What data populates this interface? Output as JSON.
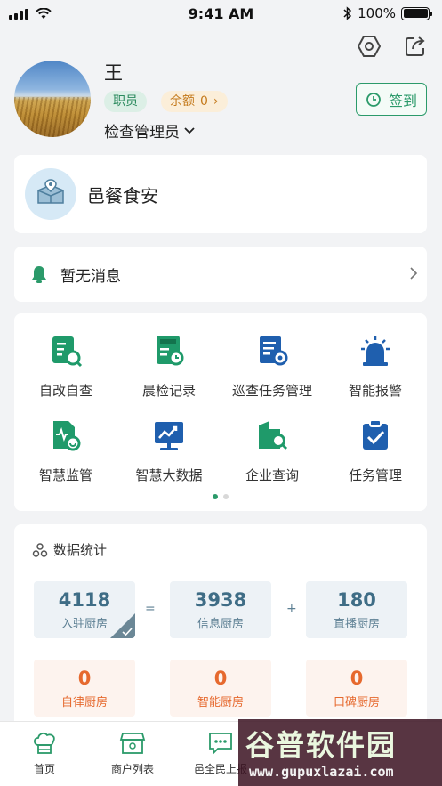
{
  "status_bar": {
    "time": "9:41 AM",
    "battery": "100%"
  },
  "profile": {
    "name": "王",
    "role": "职员",
    "balance_label": "余额",
    "balance_value": "0",
    "title": "检查管理员",
    "checkin_label": "签到"
  },
  "brand": {
    "name": "邑餐食安"
  },
  "message": {
    "text": "暂无消息"
  },
  "grid": {
    "items": [
      {
        "label": "自改自查",
        "icon": "self-check-icon"
      },
      {
        "label": "晨检记录",
        "icon": "morning-check-icon"
      },
      {
        "label": "巡查任务管理",
        "icon": "patrol-task-icon"
      },
      {
        "label": "智能报警",
        "icon": "alarm-icon"
      },
      {
        "label": "智慧监管",
        "icon": "supervision-icon"
      },
      {
        "label": "智慧大数据",
        "icon": "big-data-icon"
      },
      {
        "label": "企业查询",
        "icon": "enterprise-search-icon"
      },
      {
        "label": "任务管理",
        "icon": "task-icon"
      }
    ],
    "pages": 2,
    "active_page": 1
  },
  "stats": {
    "title": "数据统计",
    "row1": [
      {
        "value": "4118",
        "label": "入驻厨房"
      },
      {
        "value": "3938",
        "label": "信息厨房"
      },
      {
        "value": "180",
        "label": "直播厨房"
      }
    ],
    "operators": [
      "=",
      "+"
    ],
    "row2": [
      {
        "value": "0",
        "label": "自律厨房"
      },
      {
        "value": "0",
        "label": "智能厨房"
      },
      {
        "value": "0",
        "label": "口碑厨房"
      }
    ]
  },
  "tabbar": {
    "items": [
      {
        "label": "首页",
        "icon": "chef-hat-icon"
      },
      {
        "label": "商户列表",
        "icon": "shop-icon"
      },
      {
        "label": "邑全民上报",
        "icon": "chat-icon"
      }
    ]
  },
  "watermark": {
    "main": "谷普软件园",
    "sub": "www.gupuxlazai.com"
  },
  "colors": {
    "accent": "#2b9a6a",
    "blue_icon": "#1f5fae",
    "orange": "#e6692e"
  }
}
